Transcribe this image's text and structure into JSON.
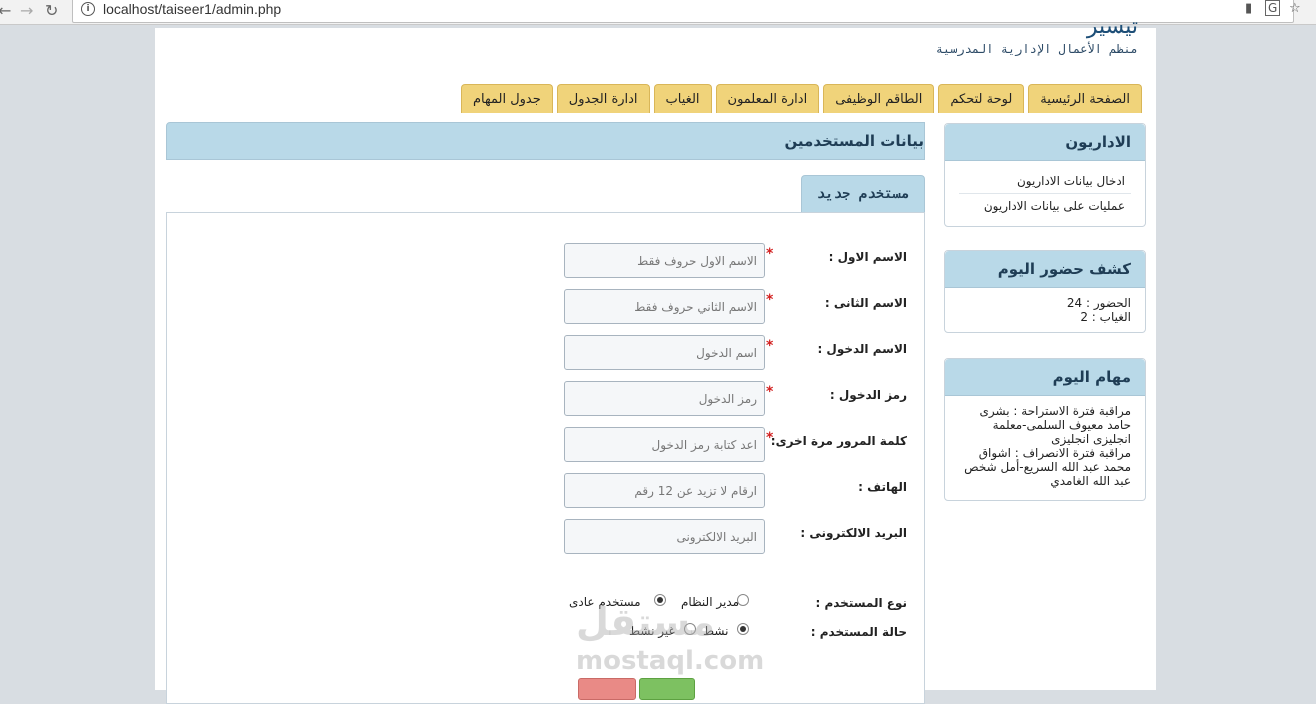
{
  "browser": {
    "url": "localhost/taiseer1/admin.php"
  },
  "site": {
    "logo_text": "تيسير",
    "subtitle": "منظم الأعمال الإدارية المدرسية"
  },
  "tabs": [
    {
      "label": "الصفحة الرئيسية"
    },
    {
      "label": "لوحة لتحكم"
    },
    {
      "label": "الطاقم الوظيفى"
    },
    {
      "label": "ادارة المعلمون"
    },
    {
      "label": "الغياب"
    },
    {
      "label": "ادارة الجدول"
    },
    {
      "label": "جدول المهام"
    }
  ],
  "sidebar": {
    "admins": {
      "title": "الاداريون",
      "links": [
        {
          "label": "ادخال بيانات الاداريون"
        },
        {
          "label": "عمليات على بيانات الاداريون"
        }
      ]
    },
    "attendance": {
      "title": "كشف حضور اليوم",
      "present": "الحضور : 24",
      "absent": "الغياب : 2"
    },
    "tasks": {
      "title": "مهام اليوم",
      "lines": [
        "مراقبة فترة الاستراحة : بشرى",
        "حامد معيوف السلمى-معلمة",
        "انجليزى انجليزى",
        "مراقبة فترة الانصراف : اشواق",
        "محمد عبد الله السريع-أمل شخص",
        "عبد الله الغامدي"
      ]
    }
  },
  "main": {
    "title": "بيانات المستخدمين",
    "subtab": "مستخدم جديد",
    "fields": [
      {
        "label": "الاسم الاول :",
        "placeholder": "الاسم الاول حروف فقط",
        "required": true
      },
      {
        "label": "الاسم الثانى :",
        "placeholder": "الاسم الثاني حروف فقط",
        "required": true
      },
      {
        "label": "الاسم الدخول :",
        "placeholder": "اسم الدخول",
        "required": true
      },
      {
        "label": "رمز الدخول :",
        "placeholder": "رمز الدخول",
        "required": true
      },
      {
        "label": "كلمة المرور مرة اخرى:",
        "placeholder": "اعد كتابة رمز الدخول",
        "required": true
      },
      {
        "label": "الهاتف :",
        "placeholder": "ارقام لا تزيد عن 12 رقم",
        "required": false
      },
      {
        "label": "البريد الالكترونى :",
        "placeholder": "البريد الالكترونى",
        "required": false
      }
    ],
    "user_type": {
      "label": "نوع المستخدم :",
      "options": [
        {
          "label": "مدير النظام",
          "selected": false
        },
        {
          "label": "مستخدم عادى",
          "selected": true
        }
      ]
    },
    "user_status": {
      "label": "حالة المستخدم :",
      "options": [
        {
          "label": "نشط",
          "selected": true
        },
        {
          "label": "غير نشط",
          "selected": false
        }
      ]
    }
  },
  "watermark": {
    "brand_ar": "مستقل",
    "brand_en": "mostaql.com"
  },
  "colors": {
    "tab_bg": "#f0d37a",
    "header_bg": "#b9d9e8",
    "required_star": "#d21f1f",
    "button_red": "#e98a86",
    "button_green": "#7dc161"
  }
}
